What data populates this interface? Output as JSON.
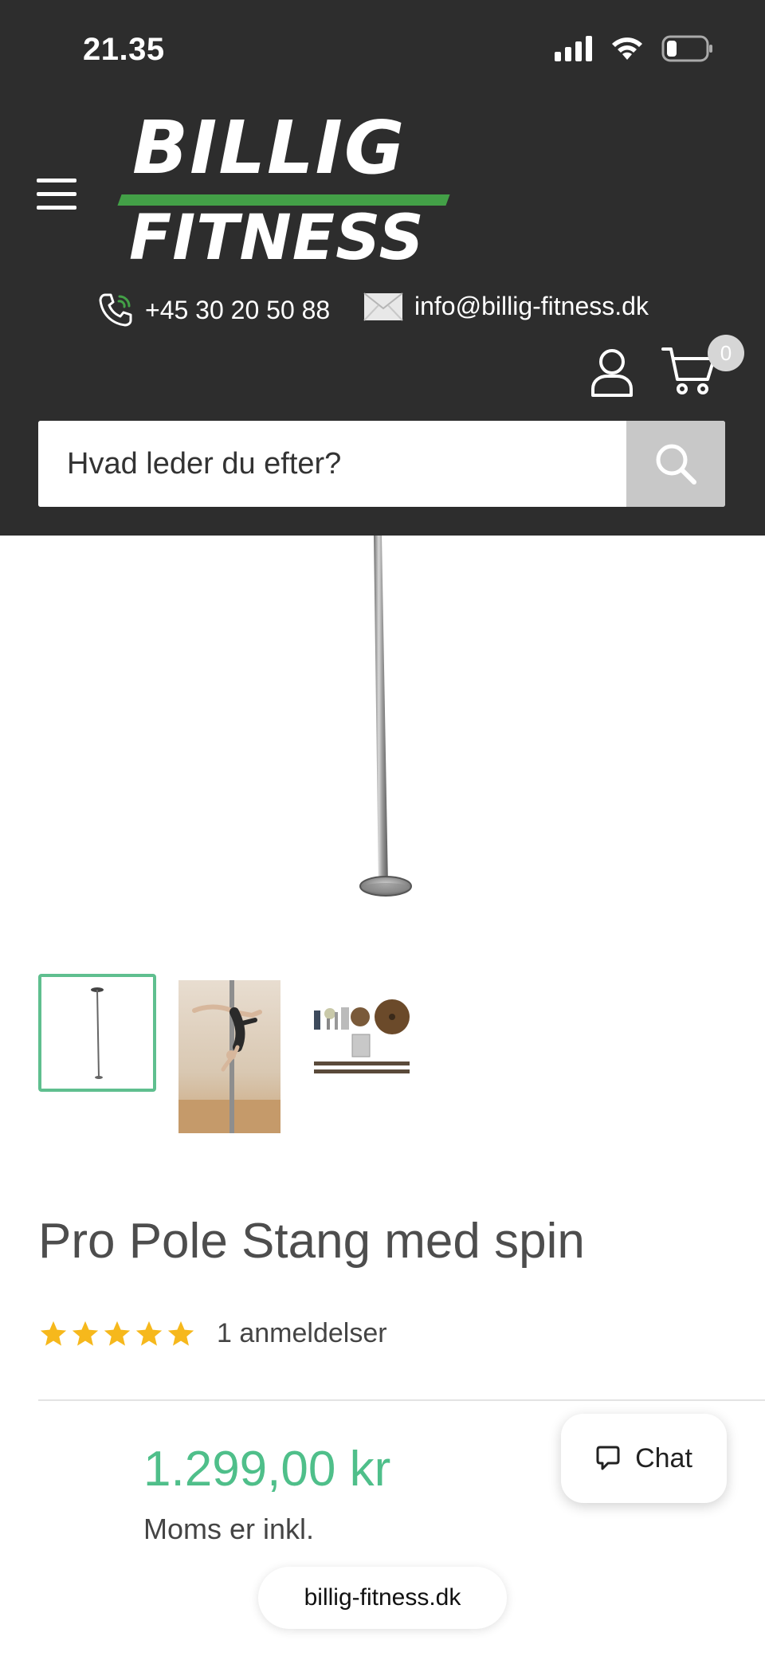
{
  "status_bar": {
    "time": "21.35"
  },
  "header": {
    "logo_line1": "BILLIG",
    "logo_line2": "FITNESS",
    "phone": "+45 30 20 50 88",
    "email": "info@billig-fitness.dk",
    "cart_count": "0",
    "brand_color": "#43a047",
    "background_color": "#2d2d2d"
  },
  "search": {
    "placeholder": "Hvad leder du efter?"
  },
  "product": {
    "title": "Pro Pole Stang med spin",
    "rating_stars": 5,
    "reviews": "1 anmeldelser",
    "price": "1.299,00 kr",
    "price_color": "#4fbf8a",
    "tax_note": "Moms er inkl.",
    "thumbnails": [
      "pole-thumbnail",
      "pole-dancer-thumbnail",
      "pole-parts-thumbnail"
    ]
  },
  "chat": {
    "label": "Chat"
  },
  "browser": {
    "url": "billig-fitness.dk"
  }
}
